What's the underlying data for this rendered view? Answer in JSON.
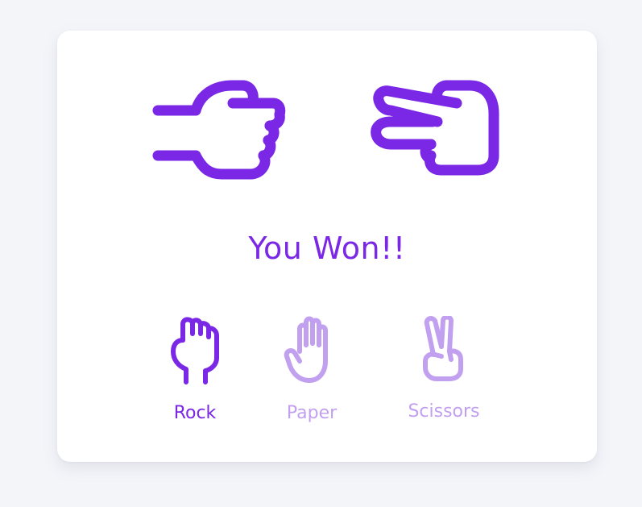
{
  "game": {
    "player_choice": "Rock",
    "computer_choice": "Scissors",
    "result_text": "You Won!!"
  },
  "choices": [
    {
      "label": "Rock",
      "icon": "rock-hand-icon",
      "selected": true
    },
    {
      "label": "Paper",
      "icon": "paper-hand-icon",
      "selected": false
    },
    {
      "label": "Scissors",
      "icon": "scissors-hand-icon",
      "selected": false
    }
  ],
  "colors": {
    "accent": "#7a27e6",
    "inactive": "#c2a0f0",
    "card": "#ffffff",
    "background": "#f4f5f9"
  }
}
